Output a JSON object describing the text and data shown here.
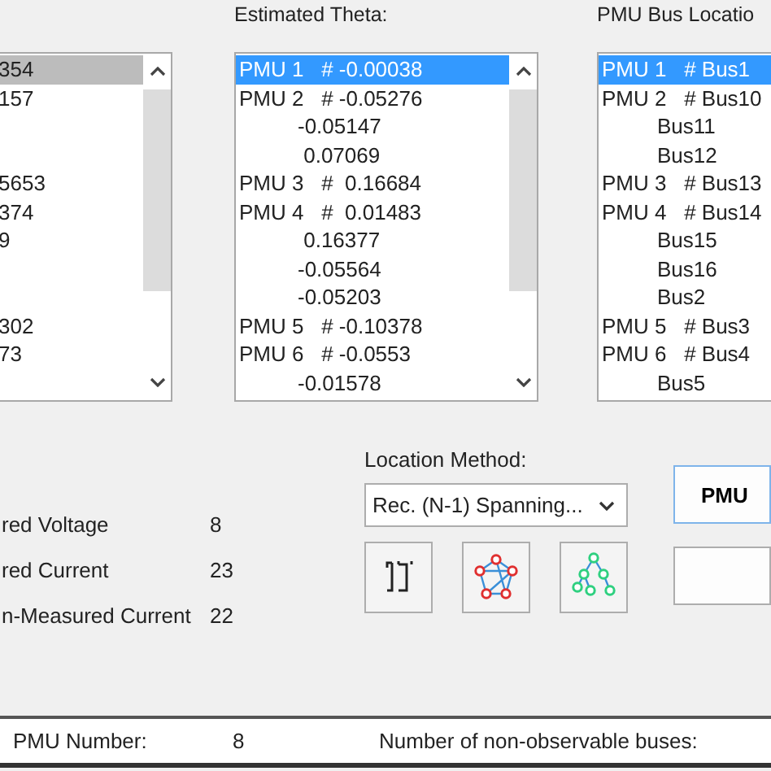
{
  "voltage_list": {
    "rows": [
      {
        "text": "354",
        "selected": true
      },
      {
        "text": "157",
        "selected": false
      },
      {},
      {},
      {
        "text": "5653",
        "selected": false
      },
      {
        "text": "374",
        "selected": false
      },
      {
        "text": "9",
        "selected": false
      },
      {},
      {},
      {
        "text": "302",
        "selected": false
      },
      {
        "text": "73",
        "selected": false
      },
      {}
    ]
  },
  "theta": {
    "title": "Estimated Theta:",
    "rows": [
      {
        "kind": "pmu",
        "text": "PMU 1   # -0.00038",
        "selected": true
      },
      {
        "kind": "pmu",
        "text": "PMU 2   # -0.05276",
        "selected": false
      },
      {
        "kind": "cont",
        "text": "-0.05147",
        "selected": false
      },
      {
        "kind": "cont",
        "text": " 0.07069",
        "selected": false
      },
      {
        "kind": "pmu",
        "text": "PMU 3   #  0.16684",
        "selected": false
      },
      {
        "kind": "pmu",
        "text": "PMU 4   #  0.01483",
        "selected": false
      },
      {
        "kind": "cont",
        "text": " 0.16377",
        "selected": false
      },
      {
        "kind": "cont",
        "text": "-0.05564",
        "selected": false
      },
      {
        "kind": "cont",
        "text": "-0.05203",
        "selected": false
      },
      {
        "kind": "pmu",
        "text": "PMU 5   # -0.10378",
        "selected": false
      },
      {
        "kind": "pmu",
        "text": "PMU 6   # -0.0553",
        "selected": false
      },
      {
        "kind": "cont",
        "text": "-0.01578",
        "selected": false
      }
    ]
  },
  "location": {
    "title": "PMU Bus Locatio",
    "rows": [
      {
        "kind": "pmu",
        "text": "PMU 1   # Bus1",
        "selected": true
      },
      {
        "kind": "pmu",
        "text": "PMU 2   # Bus10",
        "selected": false
      },
      {
        "kind": "cont",
        "text": "Bus11",
        "selected": false
      },
      {
        "kind": "cont",
        "text": "Bus12",
        "selected": false
      },
      {
        "kind": "pmu",
        "text": "PMU 3   # Bus13",
        "selected": false
      },
      {
        "kind": "pmu",
        "text": "PMU 4   # Bus14",
        "selected": false
      },
      {
        "kind": "cont",
        "text": "Bus15",
        "selected": false
      },
      {
        "kind": "cont",
        "text": "Bus16",
        "selected": false
      },
      {
        "kind": "cont",
        "text": "Bus2",
        "selected": false
      },
      {
        "kind": "pmu",
        "text": "PMU 5   # Bus3",
        "selected": false
      },
      {
        "kind": "pmu",
        "text": "PMU 6   # Bus4",
        "selected": false
      },
      {
        "kind": "cont",
        "text": "Bus5",
        "selected": false
      }
    ]
  },
  "stats": [
    {
      "label": "red Voltage",
      "value": "8"
    },
    {
      "label": "red Current",
      "value": "23"
    },
    {
      "label": "n-Measured Current",
      "value": "22"
    }
  ],
  "method": {
    "label": "Location Method:",
    "value": "Rec. (N-1) Spanning..."
  },
  "tools": [
    {
      "kind": "bracket"
    },
    {
      "kind": "graph"
    },
    {
      "kind": "tree"
    }
  ],
  "side_buttons": [
    {
      "kind": "label",
      "label": "PMU"
    },
    {
      "kind": "blank"
    }
  ],
  "status": {
    "pmu_label": "PMU Number:",
    "pmu_value": "8",
    "nonobs_label": "Number of non-observable buses:"
  }
}
